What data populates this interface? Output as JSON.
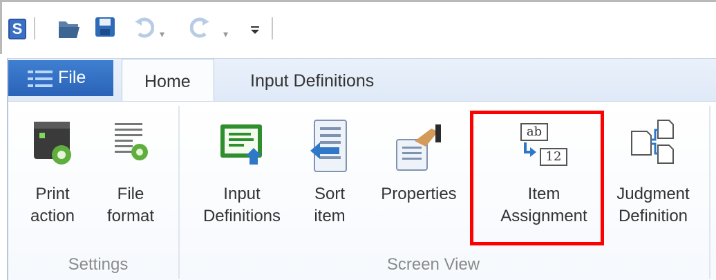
{
  "quick_access": {
    "app_letter": "S"
  },
  "tabs": {
    "file": "File",
    "home": "Home",
    "input_definitions": "Input Definitions"
  },
  "groups": {
    "settings": {
      "label": "Settings",
      "buttons": [
        {
          "line1": "Print",
          "line2": "action"
        },
        {
          "line1": "File",
          "line2": "format"
        }
      ]
    },
    "screen_view": {
      "label": "Screen View",
      "buttons": [
        {
          "line1": "Input",
          "line2": "Definitions"
        },
        {
          "line1": "Sort",
          "line2": "item"
        },
        {
          "line1": "Properties",
          "line2": ""
        },
        {
          "line1": "Item",
          "line2": "Assignment"
        },
        {
          "line1": "Judgment",
          "line2": "Definition"
        }
      ]
    }
  },
  "item_assignment_icon": {
    "top_text": "ab",
    "bottom_text": "12"
  },
  "colors": {
    "highlight": "#ff0000",
    "file_tab": "#2a63b8"
  }
}
